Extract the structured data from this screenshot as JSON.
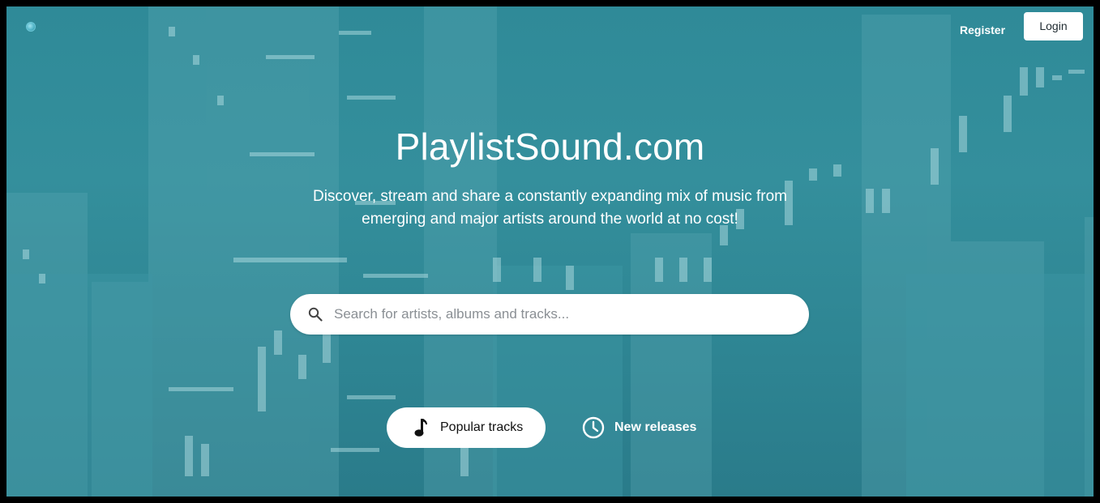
{
  "nav": {
    "register_label": "Register",
    "login_label": "Login"
  },
  "hero": {
    "title": "PlaylistSound.com",
    "subtitle": "Discover, stream and share a constantly expanding mix of music from emerging and major artists around the world at no cost!"
  },
  "search": {
    "placeholder": "Search for artists, albums and tracks...",
    "value": ""
  },
  "actions": {
    "popular_label": "Popular tracks",
    "new_label": "New releases"
  },
  "icons": {
    "logo": "globe-logo-icon",
    "search": "search-icon",
    "popular": "music-note-icon",
    "new": "clock-icon"
  },
  "colors": {
    "background_teal": "#2f8a98",
    "button_white": "#ffffff",
    "text_white": "#ffffff"
  }
}
